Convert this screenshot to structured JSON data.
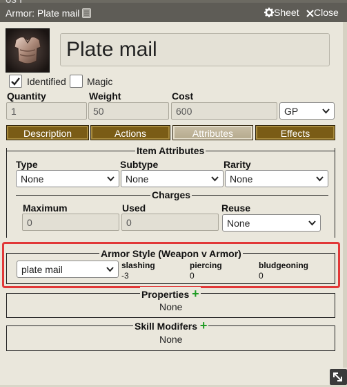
{
  "window": {
    "title": "Armor: Plate mail",
    "background_text": "os I",
    "sheet_label": "Sheet",
    "close_label": "Close"
  },
  "item": {
    "name": "Plate mail",
    "identified_label": "Identified",
    "identified_checked": true,
    "magic_label": "Magic",
    "magic_checked": false
  },
  "fields": {
    "quantity_label": "Quantity",
    "quantity_value": "1",
    "weight_label": "Weight",
    "weight_value": "50",
    "cost_label": "Cost",
    "cost_value": "600",
    "currency_value": "GP"
  },
  "tabs": [
    {
      "label": "Description",
      "active": false
    },
    {
      "label": "Actions",
      "active": false
    },
    {
      "label": "Attributes",
      "active": true
    },
    {
      "label": "Effects",
      "active": false
    }
  ],
  "item_attributes": {
    "title": "Item Attributes",
    "type_label": "Type",
    "type_value": "None",
    "subtype_label": "Subtype",
    "subtype_value": "None",
    "rarity_label": "Rarity",
    "rarity_value": "None"
  },
  "charges": {
    "title": "Charges",
    "maximum_label": "Maximum",
    "maximum_value": "0",
    "used_label": "Used",
    "used_value": "0",
    "reuse_label": "Reuse",
    "reuse_value": "None"
  },
  "armor_style": {
    "title": "Armor Style (Weapon v Armor)",
    "style_value": "plate mail",
    "slashing_label": "slashing",
    "slashing_value": "-3",
    "piercing_label": "piercing",
    "piercing_value": "0",
    "bludgeoning_label": "bludgeoning",
    "bludgeoning_value": "0"
  },
  "properties": {
    "title": "Properties",
    "value": "None"
  },
  "skill_modifiers": {
    "title": "Skill Modifers",
    "value": "None"
  },
  "colors": {
    "header_bg": "#5e5c56",
    "tab_bg": "#7a5c16",
    "tab_active_bg": "#c8bea5",
    "highlight_border": "#e13838",
    "add_icon": "#1d9b22"
  },
  "icons": [
    "note-icon",
    "gear-icon",
    "close-icon",
    "check-icon",
    "chevron-down-icon",
    "add-icon",
    "resize-icon",
    "armor-image"
  ]
}
